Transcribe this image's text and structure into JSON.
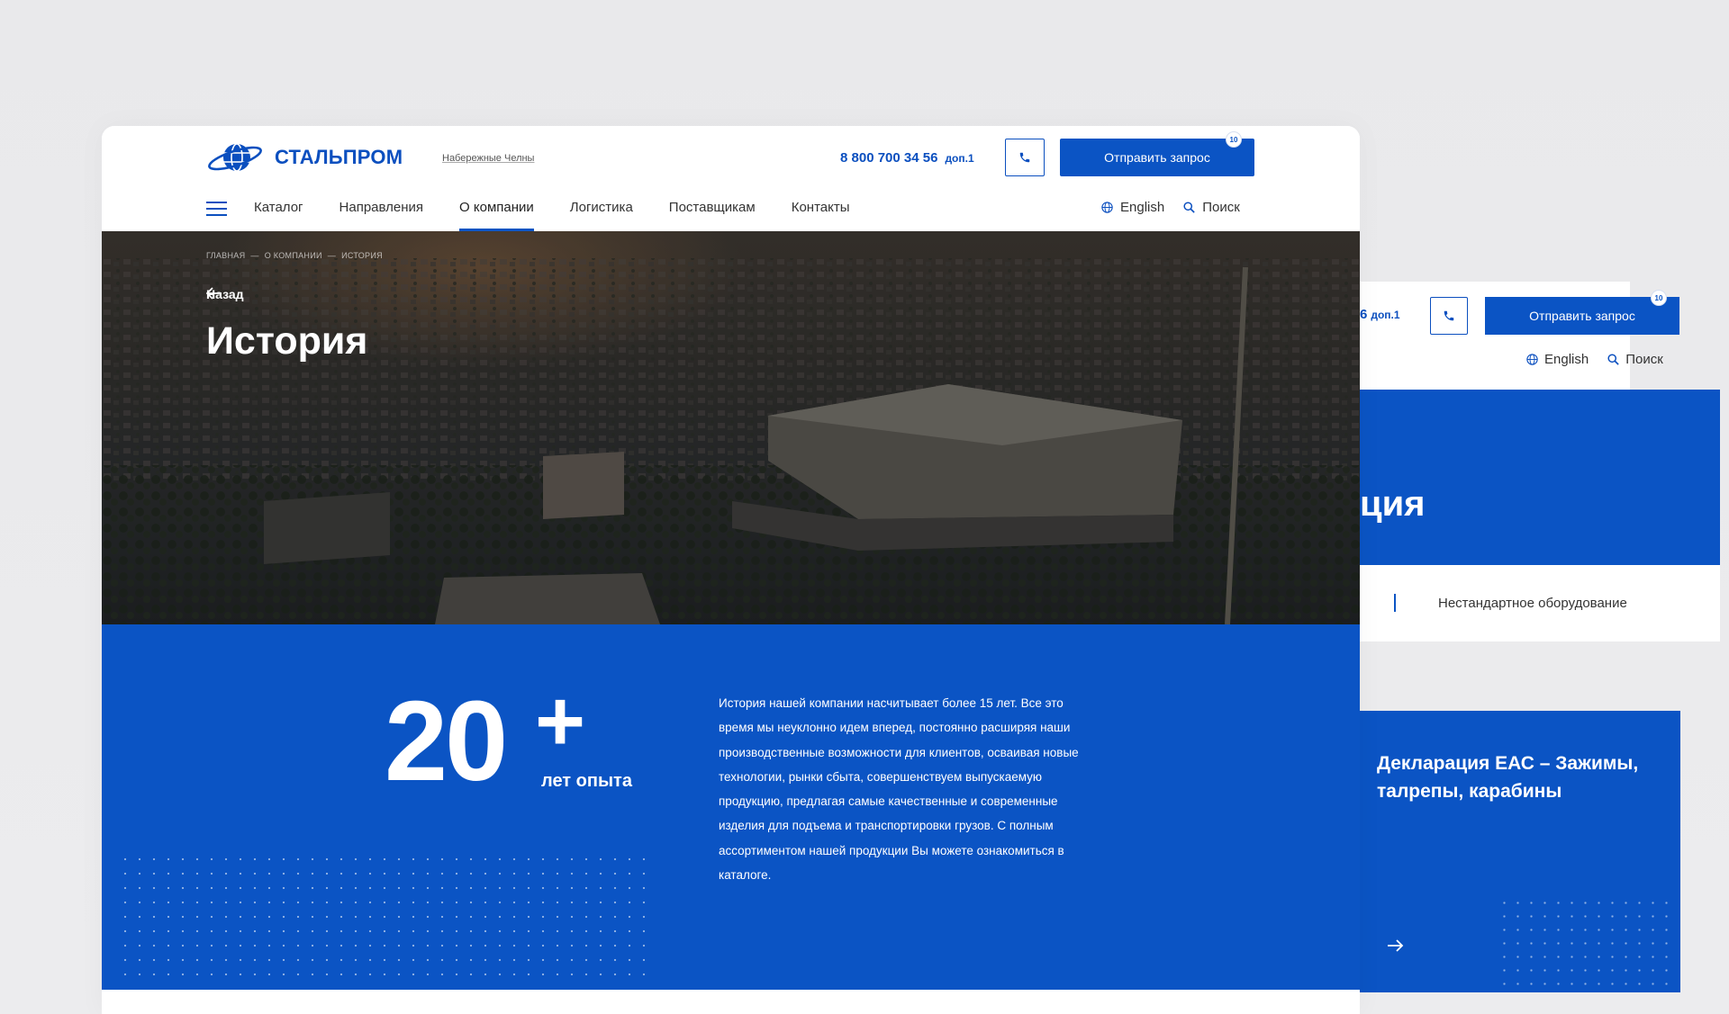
{
  "colors": {
    "brand_blue": "#0b54c4",
    "text_dark": "#333333",
    "white": "#ffffff"
  },
  "header": {
    "logo_text": "СТАЛЬПРОМ",
    "city": "Набережные Челны",
    "phone": "8 800 700 34 56",
    "phone_ext": "доп.1",
    "request_label": "Отправить запрос",
    "request_badge": "10"
  },
  "nav": {
    "items": [
      {
        "label": "Каталог"
      },
      {
        "label": "Направления"
      },
      {
        "label": "О компании",
        "active": true
      },
      {
        "label": "Логистика"
      },
      {
        "label": "Поставщикам"
      },
      {
        "label": "Контакты"
      }
    ],
    "language": "English",
    "search": "Поиск"
  },
  "hero": {
    "breadcrumb": [
      "Главная",
      "—",
      "О компании",
      "—",
      "История"
    ],
    "back_label": "Назад",
    "title": "История"
  },
  "stats": {
    "number": "20",
    "plus": "+",
    "label": "лет опыта",
    "text": "История нашей компании насчитывает более 15 лет. Все это время мы неуклонно идем вперед, постоянно расширяя наши производственные возможности для клиентов, осваивая новые технологии, рынки сбыта, совершенствуем выпускаемую продукцию, предлагая самые качественные и современные изделия для подъема и транспортировки грузов. С полным ассортиментом нашей продукции Вы можете ознакомиться в каталоге."
  },
  "back_page": {
    "phone_fragment": "6",
    "phone_ext": "доп.1",
    "request_label": "Отправить запрос",
    "request_badge": "10",
    "language": "English",
    "search": "Поиск",
    "title_fragment": "ция",
    "strip_label": "Нестандартное оборудование",
    "declaration_title": "Декларация ЕАС – Зажимы, талрепы, карабины"
  },
  "icons": [
    "globe-logo-icon",
    "phone-icon",
    "menu-icon",
    "globe-icon",
    "search-icon",
    "arrow-left-icon",
    "arrow-right-icon"
  ]
}
